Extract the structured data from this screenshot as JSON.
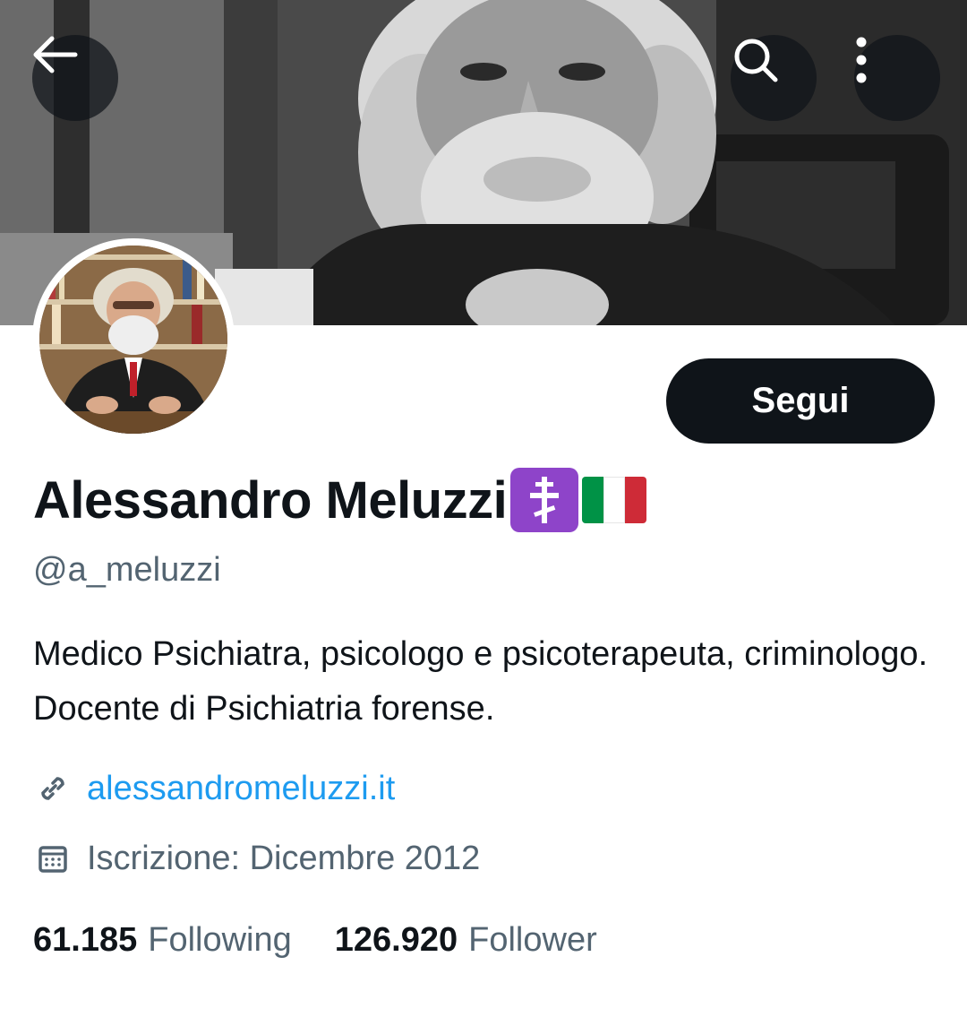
{
  "profile": {
    "display_name": "Alessandro Meluzzi",
    "handle": "@a_meluzzi",
    "bio": "Medico Psichiatra, psicologo e psicoterapeuta, criminologo. Docente di Psichiatria forense.",
    "website": "alessandromeluzzi.it",
    "joined": "Iscrizione: Dicembre 2012",
    "name_emojis": [
      "orthodox-cross-emoji",
      "italy-flag-emoji"
    ]
  },
  "actions": {
    "follow_label": "Segui"
  },
  "stats": {
    "following_count": "61.185",
    "following_label": "Following",
    "followers_count": "126.920",
    "followers_label": "Follower"
  },
  "icons": {
    "back": "back-arrow-icon",
    "search": "search-icon",
    "more": "more-vertical-icon",
    "link": "link-icon",
    "calendar": "calendar-icon"
  },
  "colors": {
    "text_primary": "#0f1419",
    "text_secondary": "#536471",
    "link": "#1d9bf0",
    "button_bg": "#0f1419",
    "emoji_cross_bg": "#8e44c9",
    "flag_green": "#009246",
    "flag_white": "#ffffff",
    "flag_red": "#ce2b37"
  }
}
